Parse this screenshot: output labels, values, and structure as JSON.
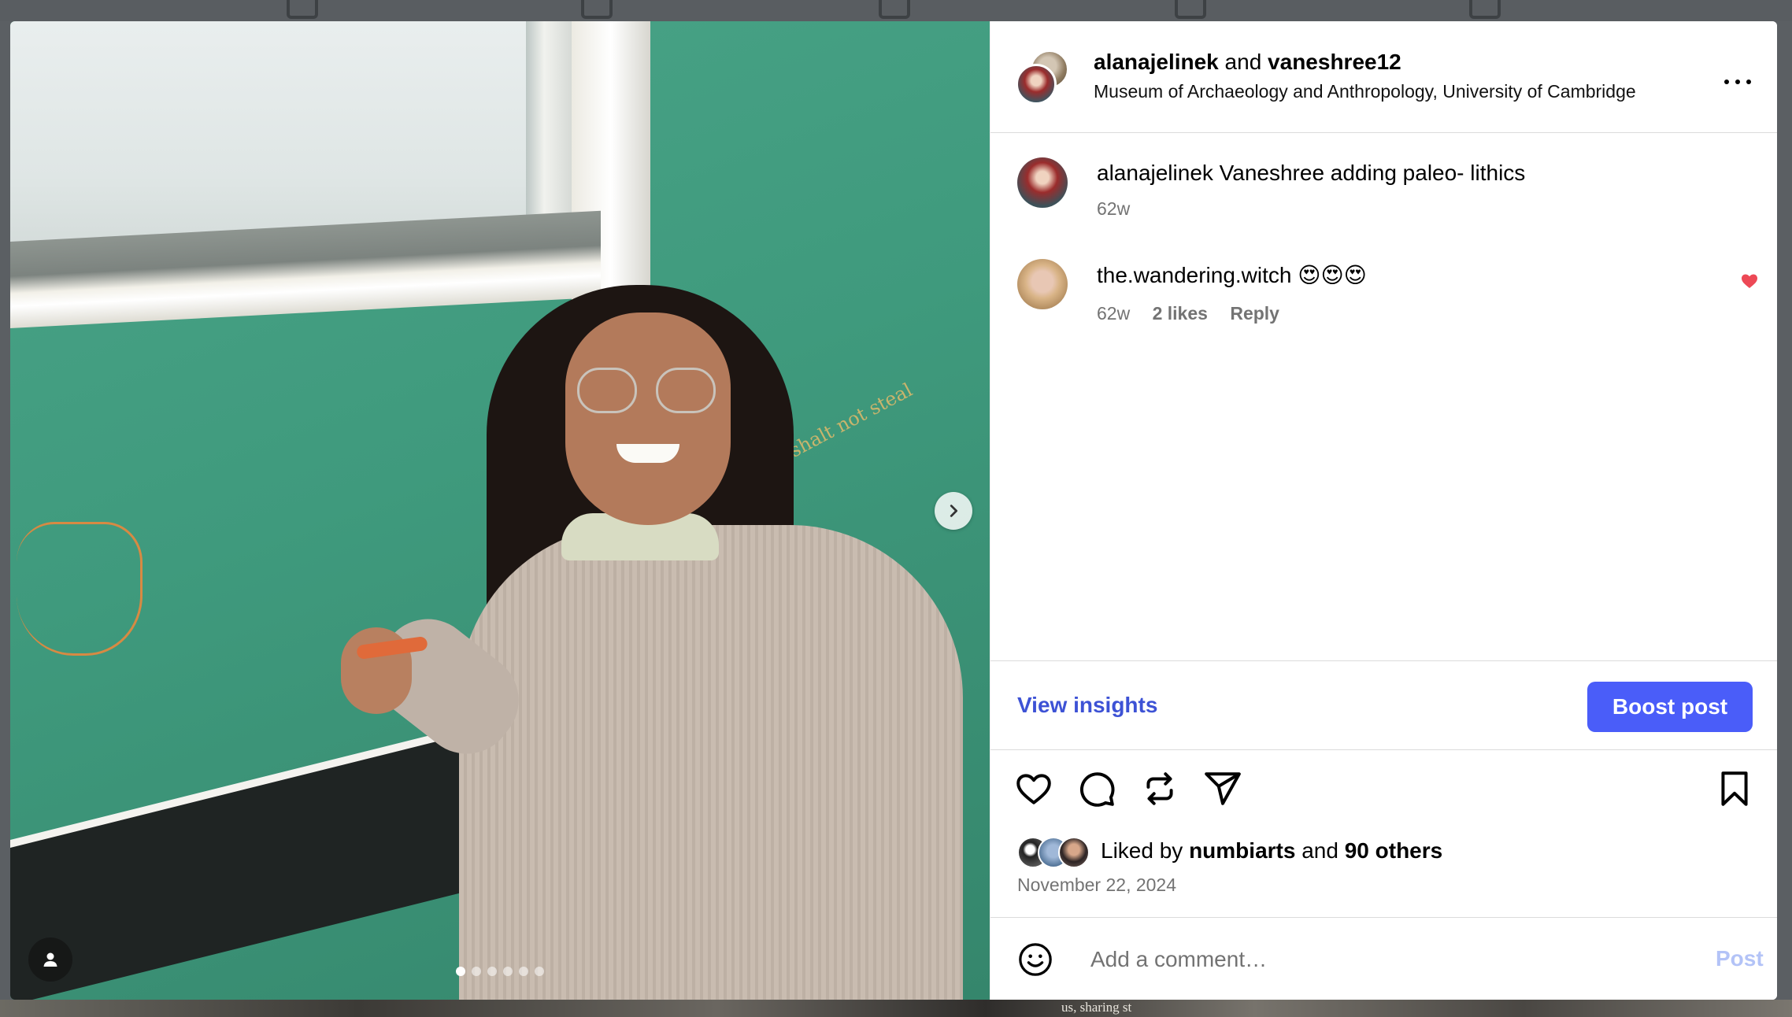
{
  "post": {
    "author": "alanajelinek",
    "and": "and",
    "collaborator": "vaneshree12",
    "location": "Museum of Archaeology and Anthropology, University of Cambridge",
    "wall_text": "shalt not steal",
    "carousel_count": 6,
    "carousel_active": 0
  },
  "comments": [
    {
      "user": "alanajelinek",
      "text": "Vaneshree adding paleo- lithics",
      "time": "62w"
    },
    {
      "user": "the.wandering.witch",
      "text": "😍😍😍",
      "time": "62w",
      "likes": "2 likes",
      "reply": "Reply",
      "liked_color": "#ed4956"
    }
  ],
  "insights": {
    "view_label": "View insights",
    "boost_label": "Boost post"
  },
  "likes": {
    "prefix": "Liked by",
    "user": "numbiarts",
    "and": "and",
    "others": "90 others",
    "date": "November 22, 2024"
  },
  "composer": {
    "placeholder": "Add a comment…",
    "post_label": "Post"
  },
  "background": {
    "partial_text": "us, sharing st"
  },
  "colors": {
    "accent": "#4a5df9",
    "link": "#3d52d5",
    "muted": "#737373",
    "post_disabled": "#b3c3f7"
  },
  "icons": {
    "next": "chevron-right-icon",
    "tag": "user-tag-icon",
    "more": "more-horizontal-icon",
    "like": "heart-icon",
    "comment": "comment-icon",
    "repost": "repost-icon",
    "share": "send-icon",
    "save": "bookmark-icon",
    "emoji": "emoji-icon"
  }
}
